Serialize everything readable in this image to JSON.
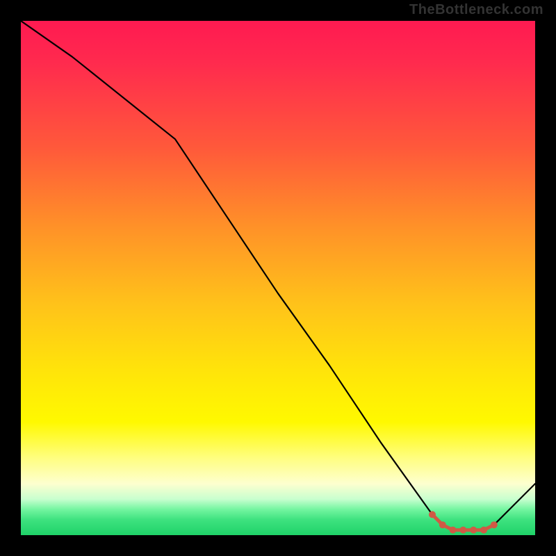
{
  "attribution": "TheBottleneck.com",
  "colors": {
    "curve": "#000000",
    "dot": "#d05a45",
    "background": "#000000"
  },
  "chart_data": {
    "type": "line",
    "title": "",
    "xlabel": "",
    "ylabel": "",
    "xlim": [
      0,
      100
    ],
    "ylim": [
      0,
      100
    ],
    "x": [
      0,
      10,
      25,
      30,
      40,
      50,
      60,
      70,
      80,
      82,
      84,
      86,
      88,
      90,
      92,
      100
    ],
    "values": [
      100,
      93,
      81,
      77,
      62,
      47,
      33,
      18,
      4,
      2,
      1,
      1,
      1,
      1,
      2,
      10
    ],
    "series": [
      {
        "name": "highlighted",
        "x": [
          80,
          82,
          84,
          86,
          88,
          90,
          92
        ],
        "values": [
          4,
          2,
          1,
          1,
          1,
          1,
          2
        ]
      }
    ]
  }
}
